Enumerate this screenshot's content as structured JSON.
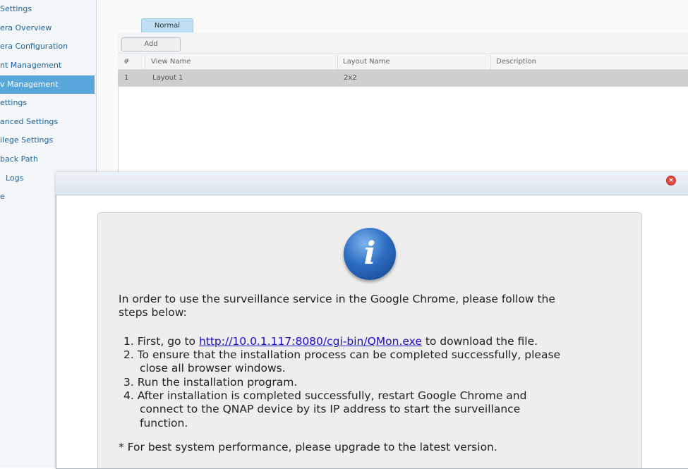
{
  "sidebar": {
    "items": [
      {
        "label": "Settings",
        "active": false
      },
      {
        "label": "era Overview",
        "active": false
      },
      {
        "label": "era Configuration",
        "active": false
      },
      {
        "label": "nt Management",
        "active": false
      },
      {
        "label": "v Management",
        "active": true
      },
      {
        "label": "ettings",
        "active": false
      },
      {
        "label": "anced Settings",
        "active": false
      },
      {
        "label": "ilege Settings",
        "active": false
      },
      {
        "label": "back Path",
        "active": false
      },
      {
        "label": "Logs",
        "active": false
      },
      {
        "label": "e",
        "active": false
      }
    ]
  },
  "main": {
    "tab": "Normal",
    "add_label": "Add",
    "columns": [
      "#",
      "View Name",
      "Layout Name",
      "Description"
    ],
    "rows": [
      {
        "num": "1",
        "view_name": "Layout 1",
        "layout_name": "2x2",
        "description": ""
      }
    ]
  },
  "dialog": {
    "close_glyph": "×",
    "icon_glyph": "i",
    "intro_line1": "In order to use the surveillance service in the Google Chrome, please follow the",
    "intro_line2": "steps below:",
    "step1_prefix": "1. First, go to ",
    "step1_link": "http://10.0.1.117:8080/cgi-bin/QMon.exe",
    "step1_suffix": " to download the file.",
    "step2_line1": "2. To ensure that the installation process can be completed successfully, please",
    "step2_line2": "close all browser windows.",
    "step3": "3. Run the installation program.",
    "step4_line1": "4. After installation is completed successfully, restart Google Chrome and",
    "step4_line2": "connect to the QNAP device by its IP address to start the surveillance",
    "step4_line3": "function.",
    "note": "* For best system performance, please upgrade to the latest version."
  },
  "colors": {
    "accent": "#5aa7dc",
    "link": "#1a0dcc",
    "close": "#e6483c"
  }
}
